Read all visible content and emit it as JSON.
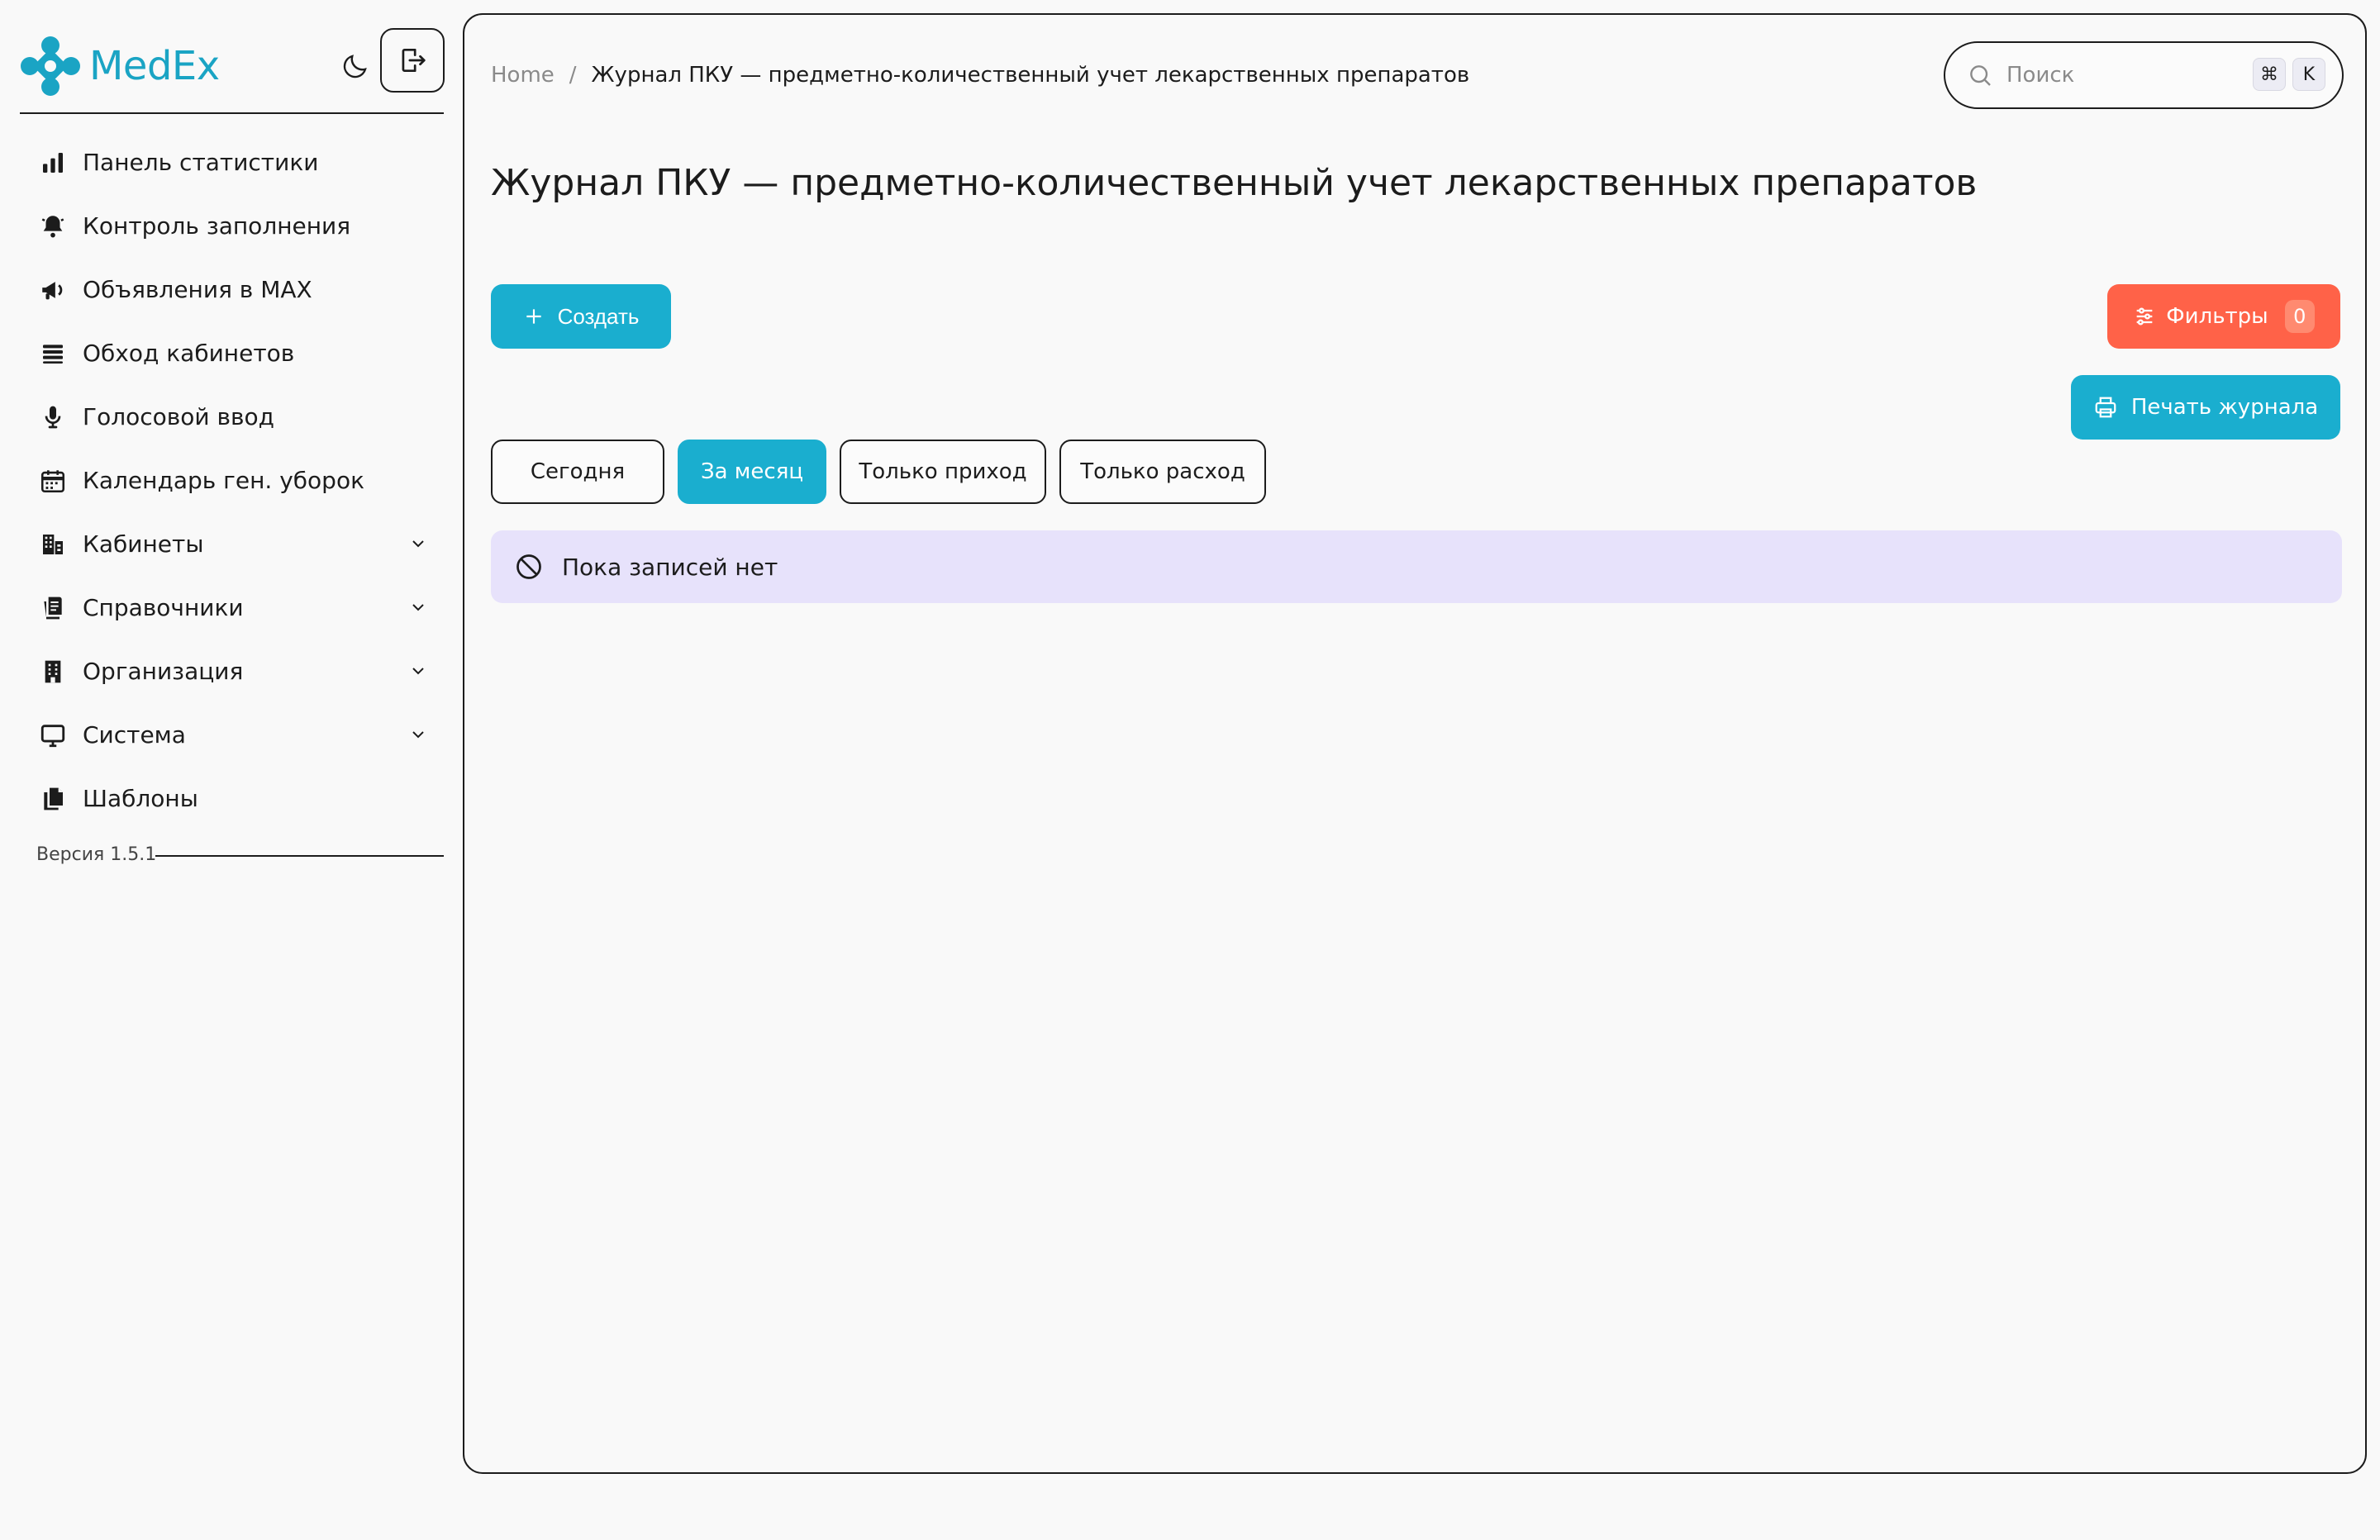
{
  "app": {
    "name": "MedEx"
  },
  "colors": {
    "accent": "#1aaecf",
    "danger": "#ff6248",
    "empty_bg": "#e7e2fb"
  },
  "sidebar": {
    "items": [
      {
        "label": "Панель статистики",
        "icon": "bar-chart-icon",
        "expandable": false
      },
      {
        "label": "Контроль заполнения",
        "icon": "bell-icon",
        "expandable": false
      },
      {
        "label": "Объявления в MAX",
        "icon": "megaphone-icon",
        "expandable": false
      },
      {
        "label": "Обход кабинетов",
        "icon": "list-icon",
        "expandable": false
      },
      {
        "label": "Голосовой ввод",
        "icon": "microphone-icon",
        "expandable": false
      },
      {
        "label": "Календарь ген. уборок",
        "icon": "calendar-icon",
        "expandable": false
      },
      {
        "label": "Кабинеты",
        "icon": "building-icon",
        "expandable": true
      },
      {
        "label": "Справочники",
        "icon": "book-icon",
        "expandable": true
      },
      {
        "label": "Организация",
        "icon": "office-icon",
        "expandable": true
      },
      {
        "label": "Система",
        "icon": "monitor-icon",
        "expandable": true
      },
      {
        "label": "Шаблоны",
        "icon": "copy-icon",
        "expandable": false
      }
    ],
    "version": "Версия 1.5.1"
  },
  "header": {
    "breadcrumb": {
      "home": "Home",
      "separator": "/",
      "current": "Журнал ПКУ — предметно-количественный учет лекарственных препаратов"
    },
    "search": {
      "placeholder": "Поиск",
      "shortcut_mod": "⌘",
      "shortcut_key": "K"
    }
  },
  "page": {
    "title": "Журнал ПКУ — предметно-количественный учет лекарственных препаратов",
    "create_label": "Создать",
    "filters_label": "Фильтры",
    "filters_count": "0",
    "print_label": "Печать журнала",
    "segments": [
      {
        "label": "Сегодня",
        "active": false
      },
      {
        "label": "За месяц",
        "active": true
      },
      {
        "label": "Только приход",
        "active": false
      },
      {
        "label": "Только расход",
        "active": false
      }
    ],
    "empty_message": "Пока записей нет"
  }
}
